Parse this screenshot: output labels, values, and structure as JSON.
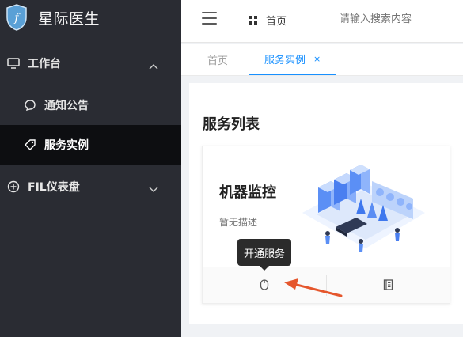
{
  "app": {
    "title": "星际医生"
  },
  "sidebar": {
    "items": [
      {
        "label": "工作台",
        "icon": "monitor-icon"
      },
      {
        "label": "通知公告",
        "icon": "chat-icon"
      },
      {
        "label": "服务实例",
        "icon": "tag-icon",
        "active": true
      },
      {
        "label": "FIL仪表盘",
        "icon": "plus-circle-icon"
      }
    ]
  },
  "header": {
    "breadcrumb": "首页",
    "search_placeholder": "请输入搜索内容"
  },
  "tabs": [
    {
      "label": "首页"
    },
    {
      "label": "服务实例",
      "active": true,
      "close": "×"
    }
  ],
  "main": {
    "title": "服务列表",
    "card": {
      "title": "机器监控",
      "description": "暂无描述",
      "actions": [
        {
          "icon": "mouse-icon"
        },
        {
          "icon": "document-icon"
        }
      ]
    },
    "tooltip": "开通服务"
  },
  "colors": {
    "sidebar_bg": "#2a2c33",
    "active_bg": "#0d0e11",
    "accent": "#1890ff",
    "annotation": "#e5562c"
  }
}
